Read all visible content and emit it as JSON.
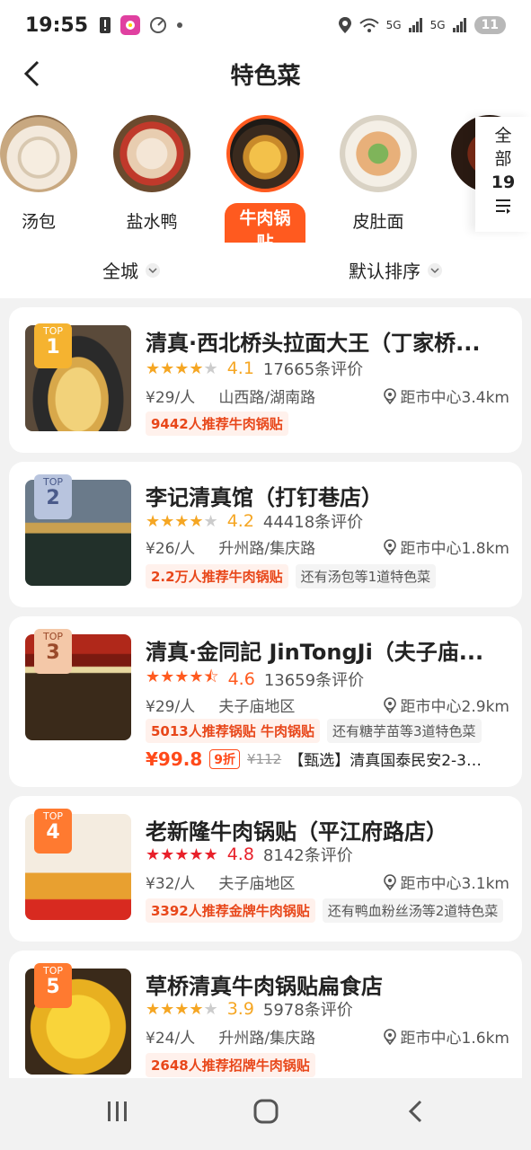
{
  "status_bar": {
    "time": "19:55",
    "signal_5g_1": "5G",
    "signal_5g_2": "5G",
    "battery": "11"
  },
  "header": {
    "title": "特色菜",
    "back_icon": "chevron-left-icon"
  },
  "categories": [
    {
      "label": "汤包",
      "active": false
    },
    {
      "label": "盐水鸭",
      "active": false
    },
    {
      "label": "牛肉锅贴",
      "active": true
    },
    {
      "label": "皮肚面",
      "active": false
    }
  ],
  "all_button": {
    "line1": "全",
    "line2": "部",
    "count": "19"
  },
  "filters": {
    "area": "全城",
    "sort": "默认排序"
  },
  "shops": [
    {
      "rank_label": "TOP",
      "rank": "1",
      "name": "清真·西北桥头拉面大王（丁家桥...",
      "stars": 4,
      "half_star": false,
      "rating": "4.1",
      "reviews": "17665条评价",
      "price": "¥29/人",
      "area": "山西路/湖南路",
      "distance": "距市中心3.4km",
      "tags": [
        "9442人推荐牛肉锅贴"
      ],
      "extra": ""
    },
    {
      "rank_label": "TOP",
      "rank": "2",
      "name": "李记清真馆（打钉巷店）",
      "stars": 4,
      "half_star": false,
      "rating": "4.2",
      "reviews": "44418条评价",
      "price": "¥26/人",
      "area": "升州路/集庆路",
      "distance": "距市中心1.8km",
      "tags": [
        "2.2万人推荐牛肉锅贴"
      ],
      "extra": "还有汤包等1道特色菜"
    },
    {
      "rank_label": "TOP",
      "rank": "3",
      "name": "清真·金同記 JinTongJi（夫子庙...",
      "stars": 4,
      "half_star": true,
      "rating": "4.6",
      "reviews": "13659条评价",
      "price": "¥29/人",
      "area": "夫子庙地区",
      "distance": "距市中心2.9km",
      "tags": [
        "5013人推荐锅贴 牛肉锅贴"
      ],
      "extra": "还有糖芋苗等3道特色菜",
      "deal": {
        "price": "¥99.8",
        "discount": "9折",
        "original": "¥112",
        "name": "【甄选】清真国泰民安2-3人..."
      }
    },
    {
      "rank_label": "TOP",
      "rank": "4",
      "name": "老新隆牛肉锅贴（平江府路店）",
      "stars": 5,
      "half_star": false,
      "rating": "4.8",
      "reviews": "8142条评价",
      "price": "¥32/人",
      "area": "夫子庙地区",
      "distance": "距市中心3.1km",
      "tags": [
        "3392人推荐金牌牛肉锅贴"
      ],
      "extra": "还有鸭血粉丝汤等2道特色菜"
    },
    {
      "rank_label": "TOP",
      "rank": "5",
      "name": "草桥清真牛肉锅贴扁食店",
      "stars": 4,
      "half_star": false,
      "rating": "3.9",
      "reviews": "5978条评价",
      "price": "¥24/人",
      "area": "升州路/集庆路",
      "distance": "距市中心1.6km",
      "tags": [
        "2648人推荐招牌牛肉锅贴"
      ],
      "extra": ""
    }
  ],
  "colors": {
    "accent": "#ff5a1f",
    "star_gold": "#f5a623",
    "star_red": "#e8202a"
  }
}
